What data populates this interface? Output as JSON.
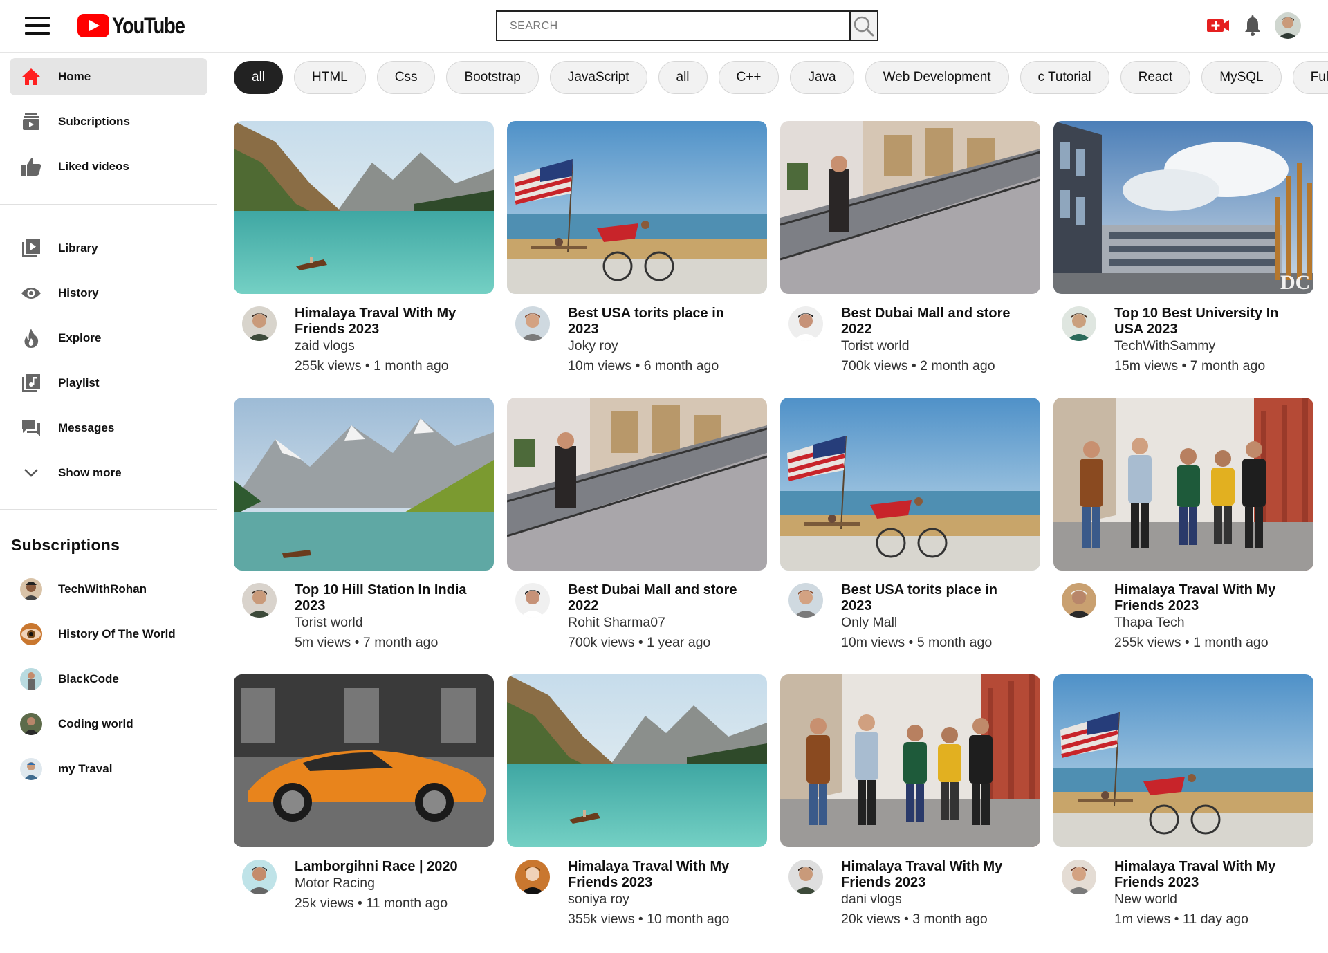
{
  "app": {
    "logo_text": "YouTube"
  },
  "search": {
    "placeholder": "SEARCH"
  },
  "sidebar": {
    "main": [
      {
        "label": "Home",
        "icon": "home-icon",
        "active": true
      },
      {
        "label": "Subcriptions",
        "icon": "subscriptions-icon"
      },
      {
        "label": "Liked videos",
        "icon": "thumbs-up-icon"
      }
    ],
    "secondary": [
      {
        "label": "Library",
        "icon": "library-icon"
      },
      {
        "label": "History",
        "icon": "eye-icon"
      },
      {
        "label": "Explore",
        "icon": "flame-icon"
      },
      {
        "label": "Playlist",
        "icon": "playlist-icon"
      },
      {
        "label": "Messages",
        "icon": "messages-icon"
      },
      {
        "label": "Show more",
        "icon": "chevron-down-icon"
      }
    ],
    "subscriptions_title": "Subscriptions",
    "subscriptions": [
      {
        "name": "TechWithRohan"
      },
      {
        "name": "History Of The World"
      },
      {
        "name": "BlackCode"
      },
      {
        "name": "Coding world"
      },
      {
        "name": "my Traval"
      }
    ]
  },
  "chips": [
    "all",
    "HTML",
    "Css",
    "Bootstrap",
    "JavaScript",
    "all",
    "C++",
    "Java",
    "Web Development",
    "c Tutorial",
    "React",
    "MySQL",
    "Full stack"
  ],
  "videos": [
    {
      "title": "Himalaya Traval With My Friends 2023",
      "channel": "zaid vlogs",
      "stats": "255k views • 1 month ago",
      "thumb": "lake"
    },
    {
      "title": "Best USA torits place in 2023",
      "channel": "Joky roy",
      "stats": "10m views • 6 month ago",
      "thumb": "flag"
    },
    {
      "title": "Best Dubai Mall and store 2022",
      "channel": "Torist world",
      "stats": "700k views • 2 month ago",
      "thumb": "mall"
    },
    {
      "title": "Top 10 Best University In USA 2023",
      "channel": "TechWithSammy",
      "stats": "15m views • 7 month ago",
      "thumb": "building"
    },
    {
      "title": "Top 10 Hill Station In India 2023",
      "channel": "Torist world",
      "stats": "5m views • 7 month ago",
      "thumb": "mountain"
    },
    {
      "title": "Best Dubai Mall and store 2022",
      "channel": "Rohit Sharma07",
      "stats": "700k views • 1 year ago",
      "thumb": "mall"
    },
    {
      "title": "Best USA torits place in 2023",
      "channel": "Only Mall",
      "stats": "10m views • 5 month ago",
      "thumb": "flag"
    },
    {
      "title": "Himalaya Traval With My Friends 2023",
      "channel": "Thapa Tech",
      "stats": "255k views • 1 month ago",
      "thumb": "friends"
    },
    {
      "title": "Lamborgihni Race | 2020",
      "channel": "Motor Racing",
      "stats": "25k views • 11 month ago",
      "thumb": "car"
    },
    {
      "title": "Himalaya Traval With My Friends 2023",
      "channel": "soniya roy",
      "stats": "355k views • 10 month ago",
      "thumb": "lake"
    },
    {
      "title": "Himalaya Traval With My Friends 2023",
      "channel": "dani vlogs",
      "stats": "20k views • 3 month ago",
      "thumb": "friends"
    },
    {
      "title": "Himalaya Traval With My Friends 2023",
      "channel": "New world",
      "stats": "1m views • 11 day ago",
      "thumb": "flag"
    }
  ],
  "colors": {
    "brand_red": "#ff0000",
    "active_chip": "#222222",
    "chip_bg": "#f2f2f2"
  }
}
